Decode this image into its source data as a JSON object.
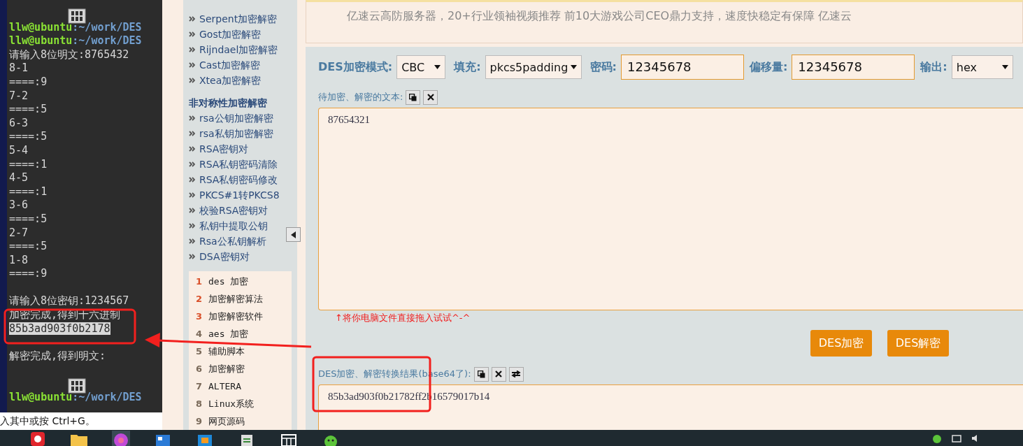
{
  "terminal": {
    "lines": [
      {
        "kind": "icon"
      },
      {
        "kind": "prompt",
        "user": "llw@ubuntu",
        "path": ":~/work/DES"
      },
      {
        "kind": "prompt",
        "user": "llw@ubuntu",
        "path": ":~/work/DES"
      },
      {
        "kind": "text",
        "text": "请输入8位明文:8765432"
      },
      {
        "kind": "text",
        "text": "8-1"
      },
      {
        "kind": "text",
        "text": "====:9"
      },
      {
        "kind": "text",
        "text": "7-2"
      },
      {
        "kind": "text",
        "text": "====:5"
      },
      {
        "kind": "text",
        "text": "6-3"
      },
      {
        "kind": "text",
        "text": "====:5"
      },
      {
        "kind": "text",
        "text": "5-4"
      },
      {
        "kind": "text",
        "text": "====:1"
      },
      {
        "kind": "text",
        "text": "4-5"
      },
      {
        "kind": "text",
        "text": "====:1"
      },
      {
        "kind": "text",
        "text": "3-6"
      },
      {
        "kind": "text",
        "text": "====:5"
      },
      {
        "kind": "text",
        "text": "2-7"
      },
      {
        "kind": "text",
        "text": "====:5"
      },
      {
        "kind": "text",
        "text": "1-8"
      },
      {
        "kind": "text",
        "text": "====:9"
      },
      {
        "kind": "blank"
      },
      {
        "kind": "text",
        "text": "请输入8位密钥:1234567"
      },
      {
        "kind": "text",
        "text": "加密完成,得到十六进制"
      },
      {
        "kind": "highlight",
        "text": "85b3ad903f0b2178"
      },
      {
        "kind": "blank"
      },
      {
        "kind": "text",
        "text": "解密完成,得到明文:"
      },
      {
        "kind": "blank"
      },
      {
        "kind": "icon"
      },
      {
        "kind": "prompt",
        "user": "llw@ubuntu",
        "path": ":~/work/DES"
      }
    ],
    "status": "入其中或按 Ctrl+G。"
  },
  "ad": {
    "text": "亿速云高防服务器，20+行业领袖视频推荐 前10大游戏公司CEO鼎力支持，速度快稳定有保障 亿速云"
  },
  "sidebar": {
    "groups": [
      {
        "items": [
          "Serpent加密解密",
          "Gost加密解密",
          "Rijndael加密解密",
          "Cast加密解密",
          "Xtea加密解密"
        ]
      },
      {
        "heading": "非对称性加密解密",
        "items": [
          "rsa公钥加密解密",
          "rsa私钥加密解密",
          "RSA密钥对",
          "RSA私钥密码清除",
          "RSA私钥密码修改",
          "PKCS#1转PKCS8",
          "校验RSA密钥对",
          "私钥中提取公钥",
          "Rsa公私钥解析",
          "DSA密钥对"
        ]
      }
    ],
    "ranking": [
      {
        "num": "1",
        "label": "des 加密",
        "color": "#d9502a"
      },
      {
        "num": "2",
        "label": "加密解密算法",
        "color": "#d9502a"
      },
      {
        "num": "3",
        "label": "加密解密软件",
        "color": "#d9502a"
      },
      {
        "num": "4",
        "label": "aes 加密",
        "color": "#7a6a5a"
      },
      {
        "num": "5",
        "label": "辅助脚本",
        "color": "#7a6a5a"
      },
      {
        "num": "6",
        "label": "加密解密",
        "color": "#7a6a5a"
      },
      {
        "num": "7",
        "label": "ALTERA",
        "color": "#7a6a5a"
      },
      {
        "num": "8",
        "label": "Linux系统",
        "color": "#7a6a5a"
      },
      {
        "num": "9",
        "label": "网页源码",
        "color": "#7a6a5a"
      }
    ]
  },
  "form": {
    "fields": [
      {
        "kind": "select",
        "label": "DES加密模式:",
        "value": "CBC"
      },
      {
        "kind": "select",
        "label": "填充:",
        "value": "pkcs5padding"
      },
      {
        "kind": "input",
        "label": "密码:",
        "value": "12345678"
      },
      {
        "kind": "input",
        "label": "偏移量:",
        "value": "12345678"
      },
      {
        "kind": "select",
        "label": "输出:",
        "value": "hex"
      }
    ],
    "source_label": "待加密、解密的文本:",
    "source_text": "87654321",
    "hint": "↑将你电脑文件直接拖入试试^-^",
    "buttons": [
      "DES加密",
      "DES解密"
    ],
    "result_label": "DES加密、解密转换结果(base64了):",
    "result_text": "85b3ad903f0b21782ff2b16579017b14"
  }
}
